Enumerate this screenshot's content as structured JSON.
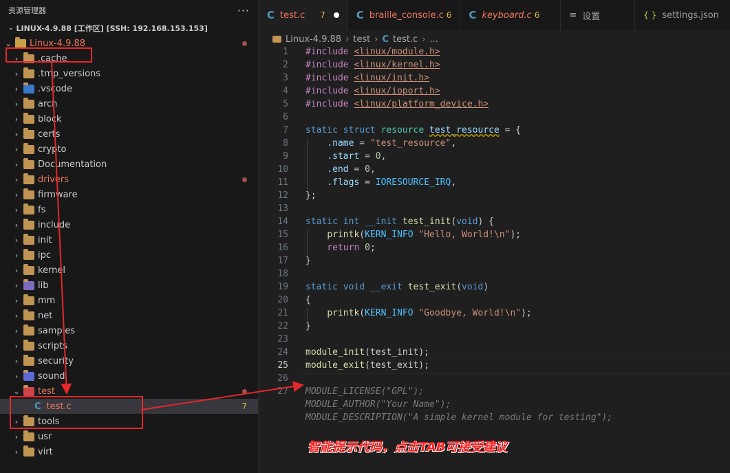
{
  "sidebar": {
    "title": "资源管理器",
    "more": "···",
    "workspace": "LINUX-4.9.88 [工作区] [SSH: 192.168.153.153]",
    "root": "Linux-4.9.88",
    "folders": [
      ".cache",
      ".tmp_versions",
      ".vscode",
      "arch",
      "block",
      "certs",
      "crypto",
      "Documentation",
      "drivers",
      "firmware",
      "fs",
      "include",
      "init",
      "ipc",
      "kernel",
      "lib",
      "mm",
      "net",
      "samples",
      "scripts",
      "security",
      "sound",
      "test"
    ],
    "file": "test.c",
    "file_count": "7",
    "after": [
      "tools",
      "usr",
      "virt"
    ]
  },
  "tabs": [
    {
      "label": "test.c",
      "count": "7"
    },
    {
      "label": "braille_console.c",
      "count": "6"
    },
    {
      "label": "keyboard.c",
      "count": "6"
    },
    {
      "label": "设置",
      "icon": "≡"
    },
    {
      "label": "settings.json",
      "icon": "{ }"
    }
  ],
  "breadcrumb": {
    "root": "Linux-4.9.88",
    "folder": "test",
    "file": "test.c",
    "tail": "..."
  },
  "code": {
    "line_numbers": [
      "1",
      "2",
      "3",
      "4",
      "5",
      "6",
      "7",
      "8",
      "9",
      "10",
      "11",
      "12",
      "13",
      "14",
      "15",
      "16",
      "17",
      "18",
      "19",
      "20",
      "21",
      "22",
      "23",
      "24",
      "25",
      "26",
      "27"
    ],
    "includes": [
      "<linux/module.h>",
      "<linux/kernel.h>",
      "<linux/init.h>",
      "<linux/ioport.h>",
      "<linux/platform_device.h>"
    ],
    "include_kw": "#include",
    "struct_line": {
      "a": "static",
      "b": "struct",
      "c": "resource",
      "d": "test_resource",
      "e": " = {"
    },
    "fields": [
      {
        "name": ".name",
        "val": "\"test_resource\"",
        "tail": ","
      },
      {
        "name": ".start",
        "val": "0",
        "tail": ","
      },
      {
        "name": ".end",
        "val": "0",
        "tail": ","
      },
      {
        "name": ".flags",
        "val": "IORESOURCE_IRQ",
        "tail": ","
      }
    ],
    "close": "};",
    "init_sig": {
      "a": "static",
      "b": "int",
      "c": "__init",
      "d": "test_init",
      "e": "void"
    },
    "printk": "printk",
    "kern": "KERN_INFO",
    "hello": "\"Hello, World!\\n\"",
    "ret": "return",
    "zero": "0",
    "brace_open": "{",
    "brace_close": "}",
    "exit_sig": {
      "a": "static",
      "b": "void",
      "c": "__exit",
      "d": "test_exit",
      "e": "void"
    },
    "bye": "\"Goodbye, World!\\n\"",
    "mod_init": {
      "fn": "module_init",
      "arg": "test_init"
    },
    "mod_exit": {
      "fn": "module_exit",
      "arg": "test_exit"
    },
    "ghost": [
      "MODULE_LICENSE(\"GPL\");",
      "MODULE_AUTHOR(\"Your Name\");",
      "MODULE_DESCRIPTION(\"A simple kernel module for testing\");"
    ]
  },
  "annotation": "智能提示代码，点击TAB可接受建议",
  "colors": {
    "accent": "#0078d4",
    "annotation": "#ff2020",
    "box": "#e5282b"
  }
}
